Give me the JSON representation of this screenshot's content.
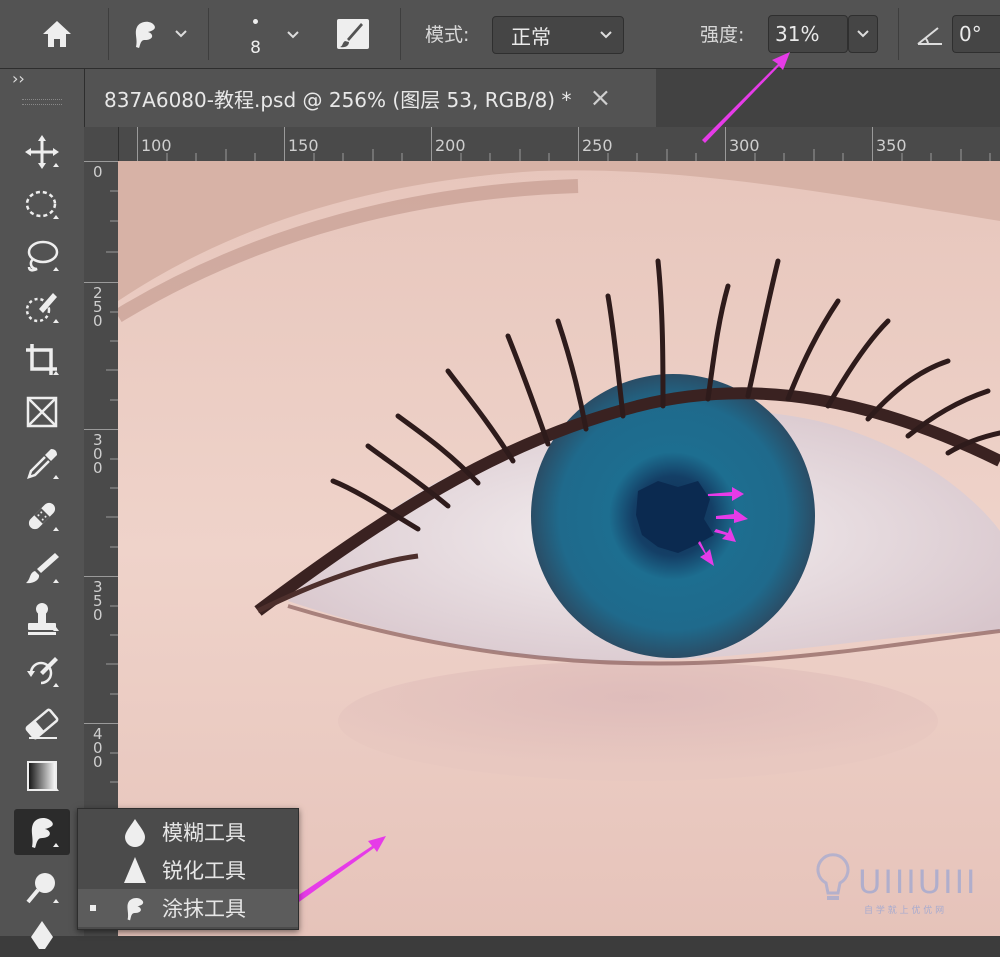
{
  "options_bar": {
    "brush_size": "8",
    "mode_label": "模式:",
    "mode_value": "正常",
    "strength_label": "强度:",
    "strength_value": "31%",
    "angle_value": "0°"
  },
  "document_tab": {
    "title": "837A6080-教程.psd @ 256% (图层 53, RGB/8) *",
    "close_glyph": "×"
  },
  "panel_collapse_glyph": "››",
  "ruler_h": [
    "100",
    "150",
    "200",
    "250",
    "300",
    "350"
  ],
  "ruler_v": [
    "0",
    "2\n5\n0",
    "3\n0\n0",
    "3\n5\n0",
    "4\n0\n0"
  ],
  "flyout": {
    "items": [
      {
        "label": "模糊工具",
        "icon": "blur-drop-icon",
        "active": false
      },
      {
        "label": "锐化工具",
        "icon": "sharpen-triangle-icon",
        "active": false
      },
      {
        "label": "涂抹工具",
        "icon": "smudge-finger-icon",
        "active": true
      }
    ]
  },
  "watermark": {
    "brand": "UIIIUIII",
    "sub": "自 学 就 上 优 优 网"
  },
  "colors": {
    "panel": "#535353",
    "annotation_arrow": "#e63be8",
    "iris": "#1f6f94"
  }
}
